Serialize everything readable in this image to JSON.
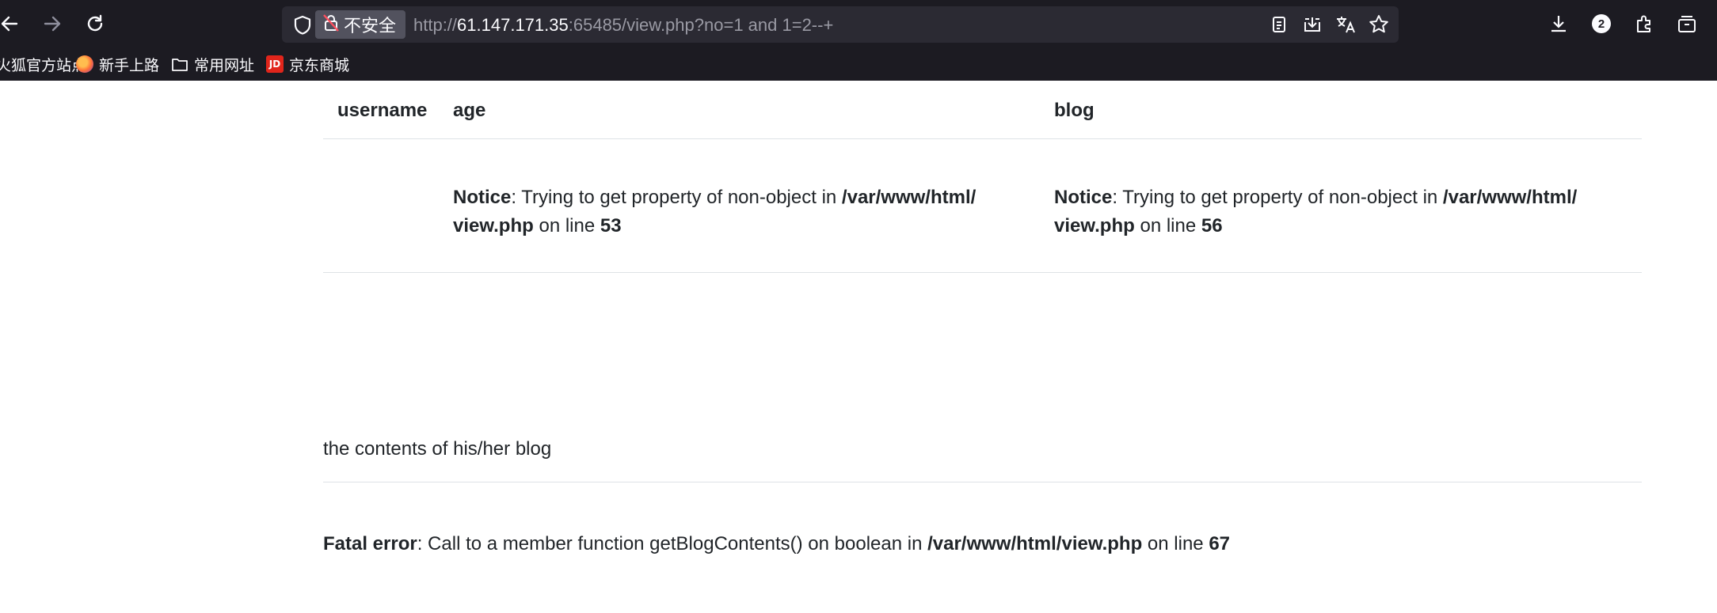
{
  "browser": {
    "security_label": "不安全",
    "url": {
      "scheme": "http://",
      "host": "61.147.171.35",
      "rest": ":65485/view.php?no=1 and 1=2--+"
    },
    "downloads_badge": "2",
    "bookmarks": [
      {
        "label": "火狐官方站点",
        "icon": "firefox-icon"
      },
      {
        "label": "新手上路",
        "icon": "firefox-icon"
      },
      {
        "label": "常用网址",
        "icon": "folder-icon"
      },
      {
        "label": "京东商城",
        "icon": "jd-icon",
        "logo_text": "JD"
      }
    ]
  },
  "table": {
    "headers": [
      "username",
      "age",
      "blog"
    ],
    "row": {
      "age": {
        "notice_label": "Notice",
        "message": ": Trying to get property of non-object in ",
        "path_line1": "/var/www/html/",
        "path_line2": "view.php",
        "on_line": " on line ",
        "line_no": "53"
      },
      "blog": {
        "notice_label": "Notice",
        "message": ": Trying to get property of non-object in ",
        "path_line1": "/var/www/html/",
        "path_line2": "view.php",
        "on_line": " on line ",
        "line_no": "56"
      }
    }
  },
  "blog_contents": "the contents of his/her blog",
  "fatal_error": {
    "label": "Fatal error",
    "message": ": Call to a member function getBlogContents() on boolean in ",
    "path": "/var/www/html/view.php",
    "on_line": " on line ",
    "line_no": "67"
  },
  "colors": {
    "chrome_bg": "#1c1b22",
    "urlbar_bg": "#2b2a33",
    "chip_bg": "#52525e",
    "divider": "#dee2e6"
  }
}
